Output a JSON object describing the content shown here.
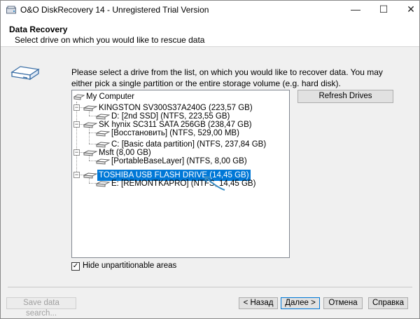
{
  "window": {
    "title": "O&O DiskRecovery 14 - Unregistered Trial Version",
    "minimize_glyph": "—",
    "maximize_glyph": "☐",
    "close_glyph": "✕"
  },
  "header": {
    "title": "Data Recovery",
    "subtitle": "Select drive on which you would like to rescue data"
  },
  "main": {
    "instructions": "Please select a drive from the list, on which you would like to recover data. You may either pick a single partition or the entire storage volume (e.g. hard disk).",
    "refresh_label": "Refresh Drives",
    "hide_unpartitionable_label": "Hide unpartitionable areas",
    "hide_unpartitionable_checked": true
  },
  "tree": {
    "root": "My Computer",
    "drives": [
      {
        "label": "KINGSTON SV300S37A240G (223,57 GB)",
        "partitions": [
          "D: [2nd SSD] (NTFS, 223,55 GB)"
        ]
      },
      {
        "label": "SK hynix SC311 SATA 256GB (238,47 GB)",
        "partitions": [
          "[Восстановить] (NTFS, 529,00 MB)",
          "C: [Basic data partition] (NTFS, 237,84 GB)"
        ]
      },
      {
        "label": "Msft (8,00 GB)",
        "partitions": [
          "[PortableBaseLayer] (NTFS, 8,00 GB)"
        ]
      },
      {
        "label": "TOSHIBA USB FLASH DRIVE (14,45 GB)",
        "selected": true,
        "partitions": [
          "E: [REMONTKAPRO] (NTFS, 14,45 GB)"
        ]
      }
    ]
  },
  "footer": {
    "save_search_label": "Save data search...",
    "back_label": "< Назад",
    "next_label": "Далее >",
    "cancel_label": "Отмена",
    "help_label": "Справка"
  },
  "colors": {
    "selection": "#0078d7",
    "arrow": "#3a8ec6"
  }
}
